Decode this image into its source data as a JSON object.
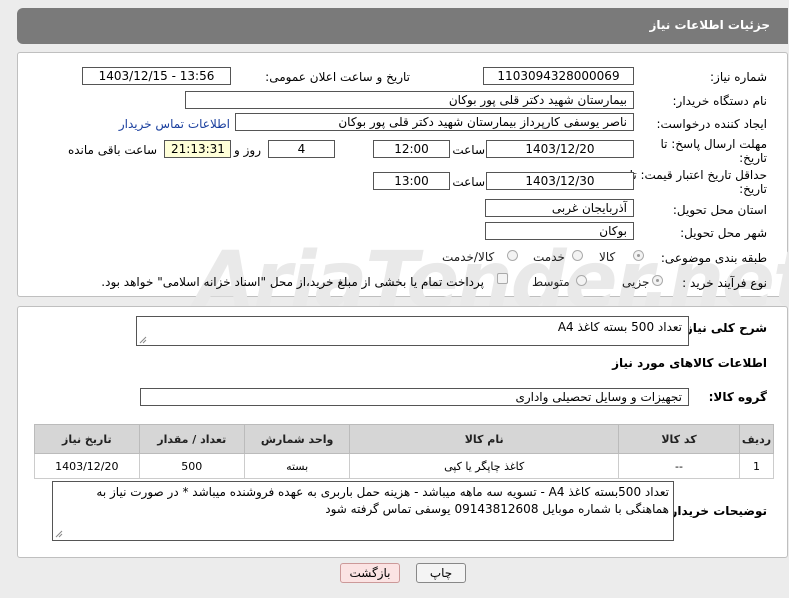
{
  "header": {
    "title": "جزئیات اطلاعات نیاز"
  },
  "form": {
    "need_number_label": "شماره نیاز:",
    "need_number": "1103094328000069",
    "announce_label": "تاریخ و ساعت اعلان عمومی:",
    "announce_value": "1403/12/15 - 13:56",
    "buyer_org_label": "نام دستگاه خریدار:",
    "buyer_org": "بیمارستان شهید دکتر قلی پور بوکان",
    "creator_label": "ایجاد کننده درخواست:",
    "creator": "ناصر یوسفی کارپرداز بیمارستان شهید دکتر قلی پور بوکان",
    "contact_link": "اطلاعات تماس خریدار",
    "deadline_label_1": "مهلت ارسال پاسخ: تا",
    "deadline_label_2": "تاریخ:",
    "deadline_date": "1403/12/20",
    "time_label": "ساعت",
    "deadline_time": "12:00",
    "days": "4",
    "days_label": "روز و",
    "remaining_time": "21:13:31",
    "remaining_label": "ساعت باقی مانده",
    "validity_label_1": "حداقل تاریخ اعتبار قیمت: تا",
    "validity_label_2": "تاریخ:",
    "validity_date": "1403/12/30",
    "validity_time": "13:00",
    "province_label": "استان محل تحویل:",
    "province": "آذربایجان غربی",
    "city_label": "شهر محل تحویل:",
    "city": "بوکان",
    "category_label": "طبقه بندی موضوعی:",
    "category_options": [
      "کالا",
      "خدمت",
      "کالا/خدمت"
    ],
    "purchase_label": "نوع فرآیند خرید :",
    "purchase_options": [
      "جزیی",
      "متوسط"
    ],
    "payment_note": "پرداخت تمام یا بخشی از مبلغ خرید،از محل \"اسناد خزانه اسلامی\" خواهد بود."
  },
  "summary": {
    "desc_label": "شرح کلی نیاز:",
    "desc_value": "تعداد 500 بسته کاغذ A4",
    "goods_info_title": "اطلاعات کالاهای مورد نیاز",
    "group_label": "گروه کالا:",
    "group_value": "تجهیزات و وسایل تحصیلی واداری"
  },
  "table": {
    "headers": [
      "ردیف",
      "کد کالا",
      "نام کالا",
      "واحد شمارش",
      "تعداد / مقدار",
      "تاریخ نیاز"
    ],
    "rows": [
      [
        "1",
        "--",
        "کاغذ چاپگر یا کپی",
        "بسته",
        "500",
        "1403/12/20"
      ]
    ]
  },
  "buyer_notes": {
    "label": "توضیحات خریدار:",
    "text": "تعداد 500بسته کاغذ A4 - تسویه سه ماهه میباشد - هزینه حمل باربری به عهده فروشنده میباشد * در صورت نیاز به هماهنگی با شماره موبایل 09143812608 یوسفی تماس گرفته شود"
  },
  "buttons": {
    "print": "چاپ",
    "back": "بازگشت"
  },
  "colors": {
    "header_bg": "#7a7a7a",
    "link": "#1a3f9e",
    "back_button": "#fbe3e3"
  }
}
